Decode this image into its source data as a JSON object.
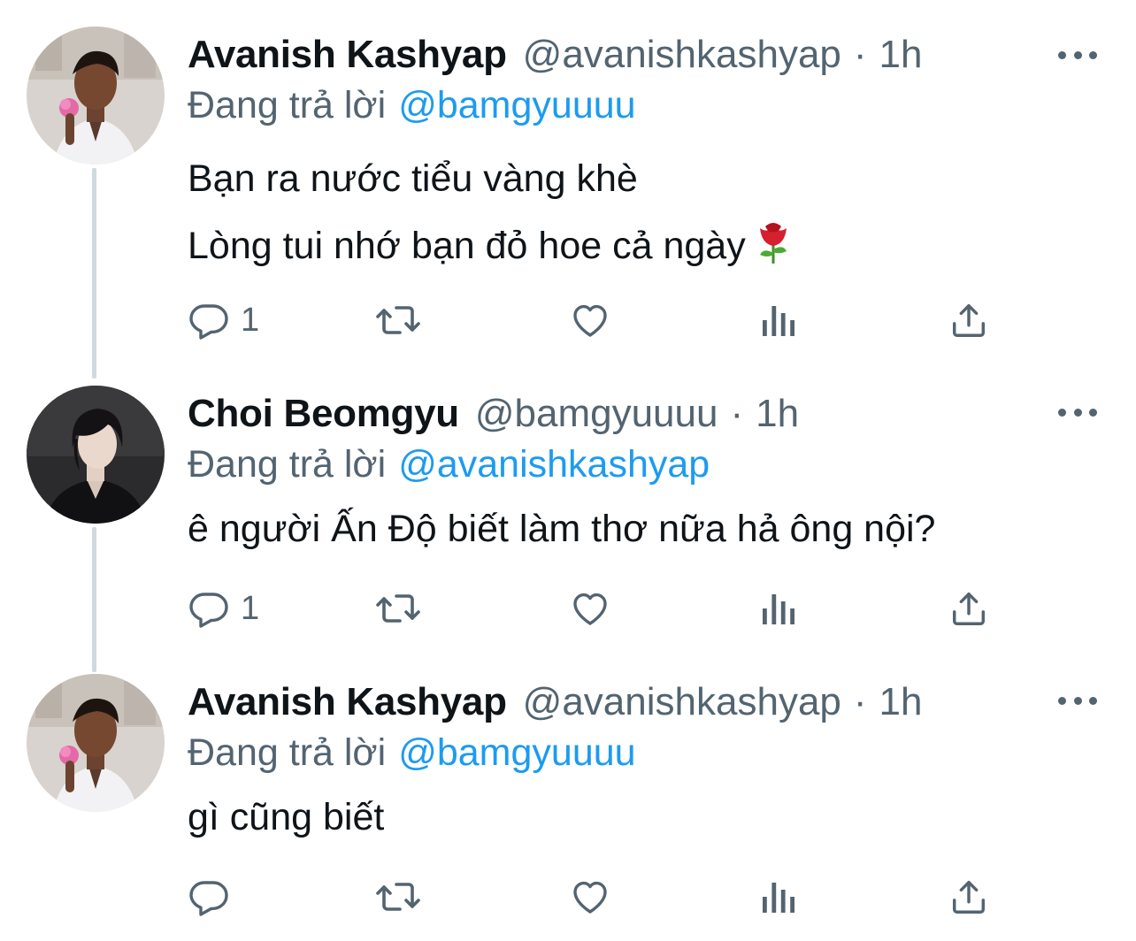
{
  "tweets": [
    {
      "display_name": "Avanish Kashyap",
      "handle": "@avanishkashyap",
      "separator": "·",
      "time": "1h",
      "replying_prefix": "Đang trả lời",
      "replying_to": "@bamgyuuuu",
      "lines": [
        "Bạn ra nước tiểu vàng khè",
        "Lòng tui nhớ bạn đỏ hoe cả ngày"
      ],
      "emoji": "rose",
      "reply_count": "1",
      "avatar": "young-man-holding-flower"
    },
    {
      "display_name": "Choi Beomgyu",
      "handle": "@bamgyuuuu",
      "separator": "·",
      "time": "1h",
      "replying_prefix": "Đang trả lời",
      "replying_to": "@avanishkashyap",
      "lines": [
        "ê người Ấn Độ biết làm thơ nữa hả ông nội?"
      ],
      "reply_count": "1",
      "avatar": "young-man-dark-jacket"
    },
    {
      "display_name": "Avanish Kashyap",
      "handle": "@avanishkashyap",
      "separator": "·",
      "time": "1h",
      "replying_prefix": "Đang trả lời",
      "replying_to": "@bamgyuuuu",
      "lines": [
        "gì cũng biết"
      ],
      "reply_count": "",
      "avatar": "young-man-holding-flower"
    }
  ],
  "icons": {
    "reply": "reply-icon",
    "retweet": "retweet-icon",
    "like": "like-icon",
    "analytics": "analytics-icon",
    "share": "share-icon",
    "more": "more-icon"
  },
  "colors": {
    "text": "#0f1419",
    "secondary": "#536471",
    "link": "#1d9bf0",
    "thread_line": "#cfd9de"
  }
}
